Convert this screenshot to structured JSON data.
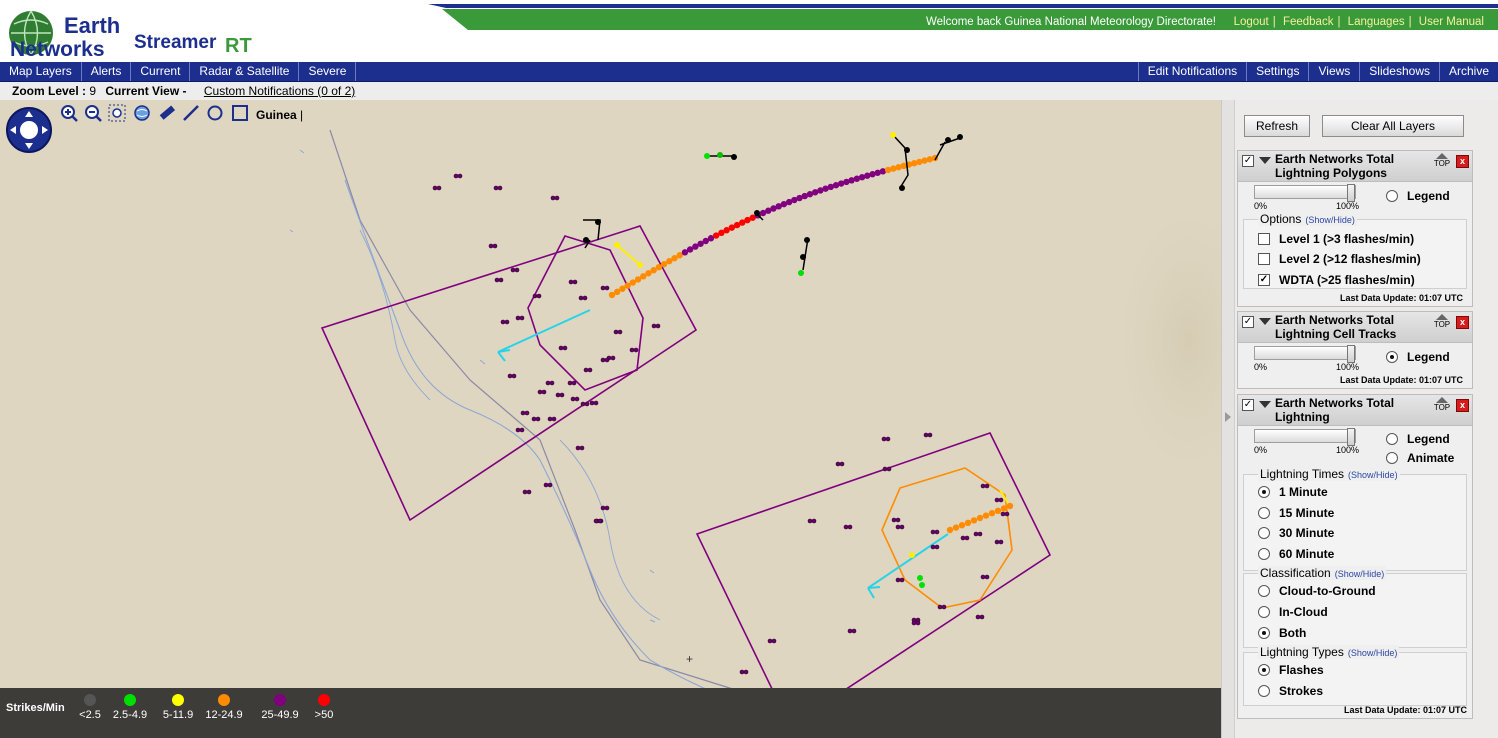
{
  "header": {
    "logo_line1": "Earth",
    "logo_line2": "Networks",
    "product": "Streamer",
    "product_rt": "RT",
    "welcome": "Welcome back  Guinea National Meteorology Directorate!",
    "links": [
      "Logout",
      "Feedback",
      "Languages",
      "User Manual"
    ],
    "brand_green": "#3a9a3a",
    "brand_blue": "#1c2f8e"
  },
  "nav": {
    "left": [
      "Map Layers",
      "Alerts",
      "Current",
      "Radar & Satellite",
      "Severe"
    ],
    "right": [
      "Edit Notifications",
      "Settings",
      "Views",
      "Slideshows",
      "Archive"
    ]
  },
  "status": {
    "zoom_label": "Zoom Level :",
    "zoom_value": "9",
    "view_label": "Current View -",
    "custom_notifications": "Custom Notifications (0 of 2)"
  },
  "map": {
    "region": "Guinea",
    "region_sep": "|",
    "tools": [
      "zoom-in-icon",
      "zoom-out-icon",
      "zoom-box-icon",
      "globe-icon",
      "ruler-icon",
      "line-icon",
      "circle-icon",
      "rectangle-icon"
    ],
    "legend_title": "Strikes/Min",
    "legend": [
      {
        "label": "<2.5",
        "color": "#555555"
      },
      {
        "label": "2.5-4.9",
        "color": "#00e000"
      },
      {
        "label": "5-11.9",
        "color": "#ffff00"
      },
      {
        "label": "12-24.9",
        "color": "#ff8c00"
      },
      {
        "label": "25-49.9",
        "color": "#800080"
      },
      {
        "label": ">50",
        "color": "#ff0000"
      }
    ]
  },
  "panel": {
    "refresh": "Refresh",
    "clear_all": "Clear All Layers",
    "top_label": "TOP",
    "close_label": "x",
    "check_mark": "✓",
    "pct_min": "0%",
    "pct_max": "100%",
    "layer1": {
      "title": "Earth Networks Total Lightning Polygons",
      "opacity_percent": 100,
      "legend": "Legend",
      "options_title": "Options",
      "show_hide": "(Show/Hide)",
      "options": [
        {
          "label": "Level 1 (>3 flashes/min)",
          "checked": false
        },
        {
          "label": "Level 2 (>12 flashes/min)",
          "checked": false
        },
        {
          "label": "WDTA (>25 flashes/min)",
          "checked": true
        }
      ],
      "last_update": "Last Data Update:  01:07 UTC"
    },
    "layer2": {
      "title": "Earth Networks Total Lightning Cell Tracks",
      "opacity_percent": 100,
      "legend": "Legend",
      "last_update": "Last Data Update:  01:07 UTC"
    },
    "layer3": {
      "title": "Earth Networks Total Lightning",
      "opacity_percent": 100,
      "legend": "Legend",
      "animate": "Animate",
      "times_title": "Lightning Times",
      "times": [
        "1 Minute",
        "15 Minute",
        "30 Minute",
        "60 Minute"
      ],
      "times_selected": 0,
      "class_title": "Classification",
      "classes": [
        "Cloud-to-Ground",
        "In-Cloud",
        "Both"
      ],
      "class_selected": 2,
      "types_title": "Lightning Types",
      "types": [
        "Flashes",
        "Strokes"
      ],
      "types_selected": 0,
      "show_hide": "(Show/Hide)",
      "last_update": "Last Data Update:  01:07 UTC"
    }
  }
}
